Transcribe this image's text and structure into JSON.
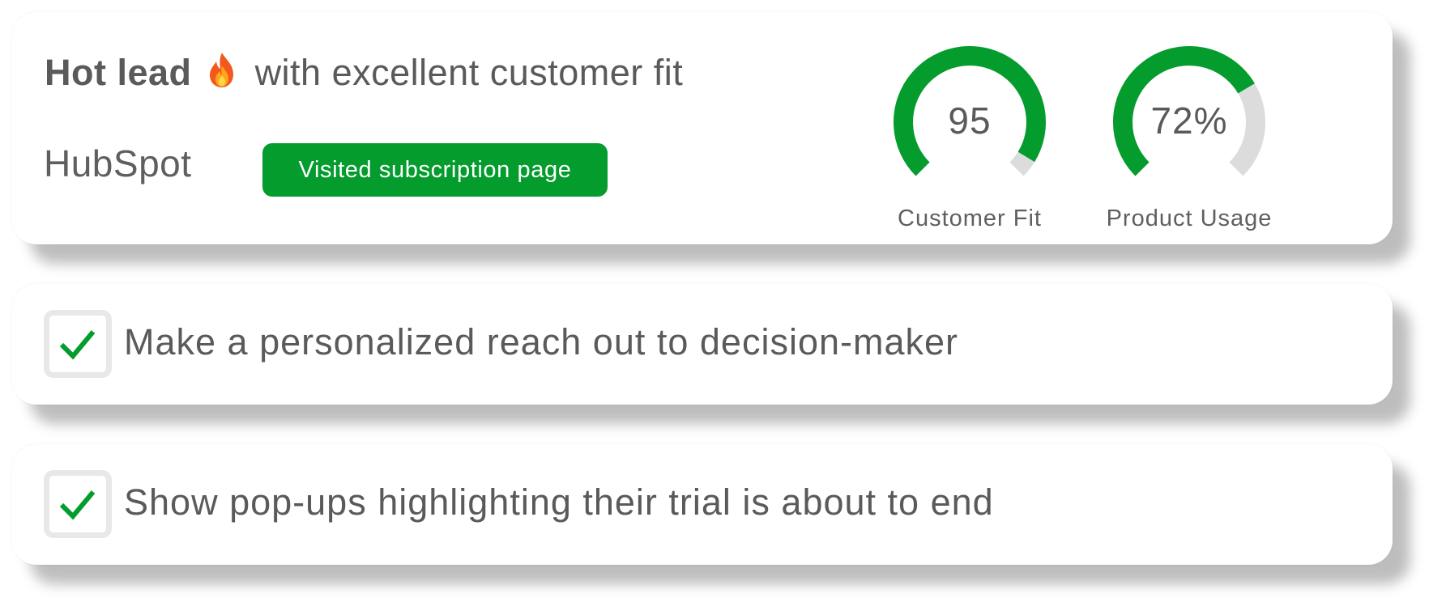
{
  "lead_card": {
    "headline_bold": "Hot lead",
    "headline_rest": "with excellent customer fit",
    "company": "HubSpot",
    "tag": "Visited subscription page",
    "gauges": [
      {
        "value_text": "95",
        "label": "Customer Fit",
        "fill_fraction": 0.95
      },
      {
        "value_text": "72%",
        "label": "Product Usage",
        "fill_fraction": 0.72
      }
    ]
  },
  "tasks": [
    {
      "text": "Make a personalized reach out to decision-maker",
      "checked": true
    },
    {
      "text": "Show pop-ups highlighting their trial is about to end",
      "checked": true
    }
  ],
  "colors": {
    "accent_green": "#039c2d",
    "gauge_track": "#dcdcdc",
    "text": "#5f5f5f",
    "checkbox_border": "#e8e8e8"
  },
  "icons": {
    "headline_icon": "fire-icon",
    "task_icon": "check-icon"
  }
}
